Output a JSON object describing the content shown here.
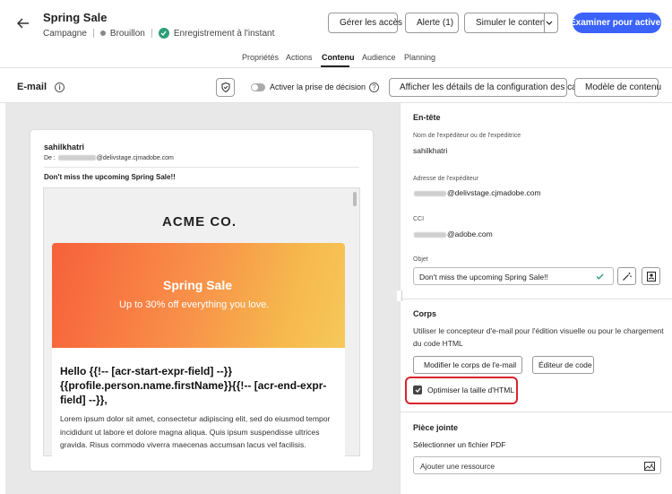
{
  "header": {
    "title": "Spring Sale",
    "type": "Campagne",
    "status": "Brouillon",
    "save_status": "Enregistrement à l'instant",
    "buttons": {
      "access": "Gérer les accès",
      "alert": "Alerte (1)",
      "simulate": "Simuler le contenu",
      "review": "Examiner pour activer"
    }
  },
  "tabs": [
    "Propriétés",
    "Actions",
    "Contenu",
    "Audience",
    "Planning"
  ],
  "active_tab": "Contenu",
  "toolbar": {
    "title": "E-mail",
    "decision_toggle": "Activer la prise de décision",
    "config_details": "Afficher les détails de la configuration des canaux",
    "template": "Modèle de contenu"
  },
  "email_preview": {
    "sender": "sahilkhatri",
    "from_prefix": "De :",
    "from_domain": "@delivstage.cjmadobe.com",
    "subject": "Don't miss the upcoming Spring Sale!!",
    "brand": "ACME CO.",
    "hero_title": "Spring Sale",
    "hero_subtitle": "Up to 30% off everything you love.",
    "greeting": "Hello {{!-- [acr-start-expr-field] --}}{{profile.person.name.firstName}}{{!-- [acr-end-expr-field] --}},",
    "body_text": "Lorem ipsum dolor sit amet, consectetur adipiscing elit, sed do eiusmod tempor incididunt ut labore et dolore magna aliqua. Quis ipsum suspendisse ultrices gravida. Risus commodo viverra maecenas accumsan lacus vel facilisis."
  },
  "panel": {
    "header_section": "En-tête",
    "sender_name_label": "Nom de l'expéditeur ou de l'expéditrice",
    "sender_name": "sahilkhatri",
    "sender_address_label": "Adresse de l'expéditeur",
    "sender_address_domain": "@delivstage.cjmadobe.com",
    "bcc_label": "CCI",
    "bcc_domain": "@adobe.com",
    "subject_label": "Objet",
    "subject_value": "Don't miss the upcoming Spring Sale!!",
    "body_section": "Corps",
    "body_desc": "Utiliser le concepteur d'e-mail pour l'édition visuelle ou pour le chargement du code HTML",
    "edit_body": "Modifier le corps de l'e-mail",
    "code_editor": "Éditeur de code",
    "optimize_html": "Optimiser la taille d'HTML",
    "attachment_section": "Pièce jointe",
    "attachment_desc": "Sélectionner un fichier PDF",
    "add_resource": "Ajouter une ressource"
  },
  "colors": {
    "primary": "#3b63fb",
    "success": "#2d9d78",
    "highlight": "#d9232e",
    "hero_start": "#f7603a",
    "hero_end": "#f6c85a"
  }
}
